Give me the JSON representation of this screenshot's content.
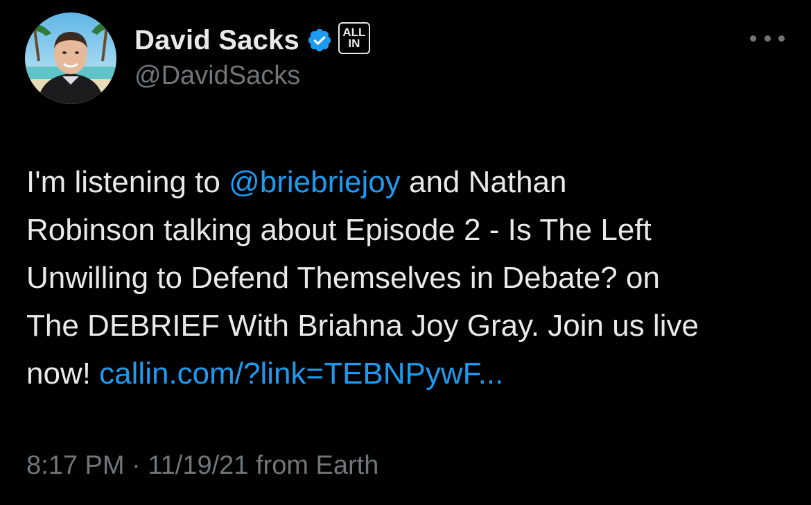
{
  "author": {
    "display_name": "David Sacks",
    "handle": "@DavidSacks",
    "verified_icon": "verified-badge-icon",
    "affiliate_badge": {
      "line1": "ALL",
      "line2": "IN"
    }
  },
  "menu": {
    "more_icon": "more-horizontal-icon"
  },
  "tweet": {
    "line1_pre": "I'm listening to ",
    "mention": "@briebriejoy",
    "line1_post": " and Nathan",
    "line2": "Robinson talking about Episode 2 - Is The Left",
    "line3": "Unwilling to Defend Themselves in Debate? on",
    "line4": "The DEBRIEF With Briahna Joy Gray. Join us live",
    "line5_pre": "now! ",
    "link": "callin.com/?link=TEBNPywF..."
  },
  "meta": {
    "time": "8:17 PM",
    "separator": " · ",
    "date": "11/19/21",
    "source": " from Earth"
  },
  "colors": {
    "background": "#000000",
    "text": "#e7e9ea",
    "secondary": "#71767b",
    "link": "#1d9bf0",
    "verified": "#1d9bf0"
  }
}
